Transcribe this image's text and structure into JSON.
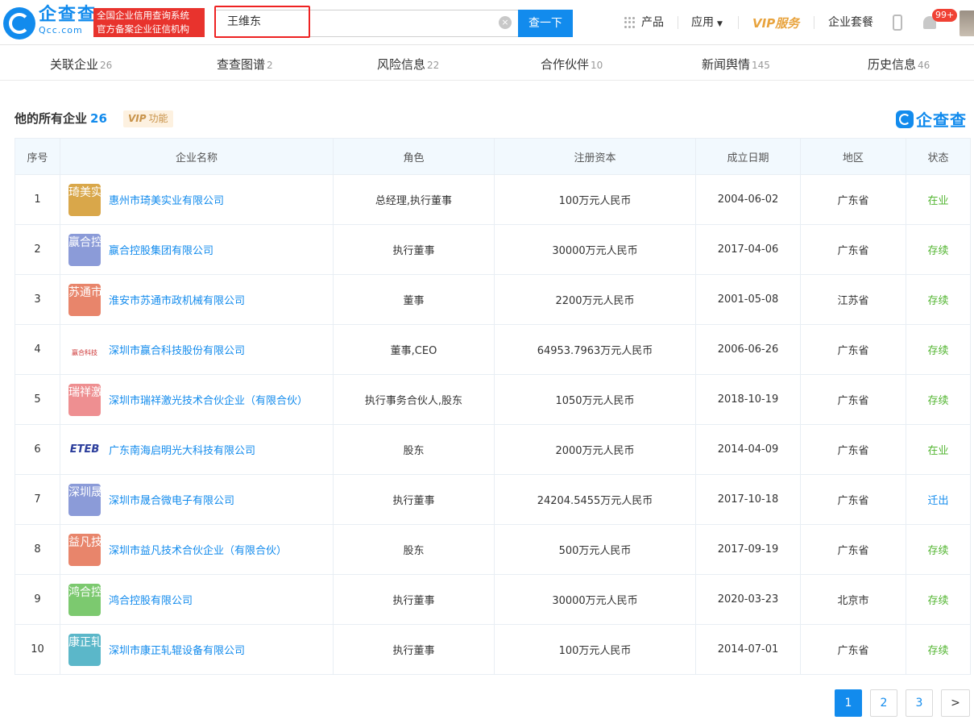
{
  "header": {
    "logo_cn": "企查查",
    "logo_en": "Qcc.com",
    "slogan_line1": "全国企业信用查询系统",
    "slogan_line2": "官方备案企业征信机构",
    "search_value": "王维东",
    "search_button": "查一下",
    "nav": {
      "products": "产品",
      "apps": "应用",
      "vip": "VIP服务",
      "packages": "企业套餐"
    },
    "notification_count": "99+"
  },
  "tabs": [
    {
      "label": "关联企业",
      "count": "26"
    },
    {
      "label": "查查图谱",
      "count": "2"
    },
    {
      "label": "风险信息",
      "count": "22"
    },
    {
      "label": "合作伙伴",
      "count": "10"
    },
    {
      "label": "新闻舆情",
      "count": "145"
    },
    {
      "label": "历史信息",
      "count": "46"
    }
  ],
  "section": {
    "title": "他的所有企业",
    "count": "26",
    "vip_tag_vip": "VIP",
    "vip_tag_label": "功能",
    "brand": "企查查"
  },
  "table": {
    "headers": [
      "序号",
      "企业名称",
      "角色",
      "注册资本",
      "成立日期",
      "地区",
      "状态"
    ],
    "rows": [
      {
        "no": "1",
        "logo": "琦美实业",
        "logo_color": "#d9a74a",
        "name": "惠州市琦美实业有限公司",
        "role": "总经理,执行董事",
        "capital": "100万元人民币",
        "date": "2004-06-02",
        "region": "广东省",
        "status": "在业",
        "status_color": "#52b530"
      },
      {
        "no": "2",
        "logo": "赢合控股",
        "logo_color": "#8b9bd8",
        "name": "嬴合控股集团有限公司",
        "role": "执行董事",
        "capital": "30000万元人民币",
        "date": "2017-04-06",
        "region": "广东省",
        "status": "存续",
        "status_color": "#52b530"
      },
      {
        "no": "3",
        "logo": "苏通市政",
        "logo_color": "#e8856b",
        "name": "淮安市苏通市政机械有限公司",
        "role": "董事",
        "capital": "2200万元人民币",
        "date": "2001-05-08",
        "region": "江苏省",
        "status": "存续",
        "status_color": "#52b530"
      },
      {
        "no": "4",
        "logo": "赢合科技",
        "logo_color": "img",
        "name": "深圳市赢合科技股份有限公司",
        "role": "董事,CEO",
        "capital": "64953.7963万元人民币",
        "date": "2006-06-26",
        "region": "广东省",
        "status": "存续",
        "status_color": "#52b530"
      },
      {
        "no": "5",
        "logo": "瑞祥激光",
        "logo_color": "#ee8f91",
        "name": "深圳市瑞祥激光技术合伙企业（有限合伙）",
        "role": "执行事务合伙人,股东",
        "capital": "1050万元人民币",
        "date": "2018-10-19",
        "region": "广东省",
        "status": "存续",
        "status_color": "#52b530"
      },
      {
        "no": "6",
        "logo": "ETEB",
        "logo_color": "stripe",
        "name": "广东南海启明光大科技有限公司",
        "role": "股东",
        "capital": "2000万元人民币",
        "date": "2014-04-09",
        "region": "广东省",
        "status": "在业",
        "status_color": "#52b530"
      },
      {
        "no": "7",
        "logo": "深圳晟合",
        "logo_color": "#8b9bd8",
        "name": "深圳市晟合微电子有限公司",
        "role": "执行董事",
        "capital": "24204.5455万元人民币",
        "date": "2017-10-18",
        "region": "广东省",
        "status": "迁出",
        "status_color": "#128bed"
      },
      {
        "no": "8",
        "logo": "益凡技术",
        "logo_color": "#e8856b",
        "name": "深圳市益凡技术合伙企业（有限合伙）",
        "role": "股东",
        "capital": "500万元人民币",
        "date": "2017-09-19",
        "region": "广东省",
        "status": "存续",
        "status_color": "#52b530"
      },
      {
        "no": "9",
        "logo": "鸿合控股",
        "logo_color": "#7cc96f",
        "name": "鸿合控股有限公司",
        "role": "执行董事",
        "capital": "30000万元人民币",
        "date": "2020-03-23",
        "region": "北京市",
        "status": "存续",
        "status_color": "#52b530"
      },
      {
        "no": "10",
        "logo": "康正轧辊",
        "logo_color": "#5bb7c9",
        "name": "深圳市康正轧辊设备有限公司",
        "role": "执行董事",
        "capital": "100万元人民币",
        "date": "2014-07-01",
        "region": "广东省",
        "status": "存续",
        "status_color": "#52b530"
      }
    ]
  },
  "pagination": {
    "pages": [
      "1",
      "2",
      "3"
    ],
    "next": ">",
    "active": "1"
  }
}
